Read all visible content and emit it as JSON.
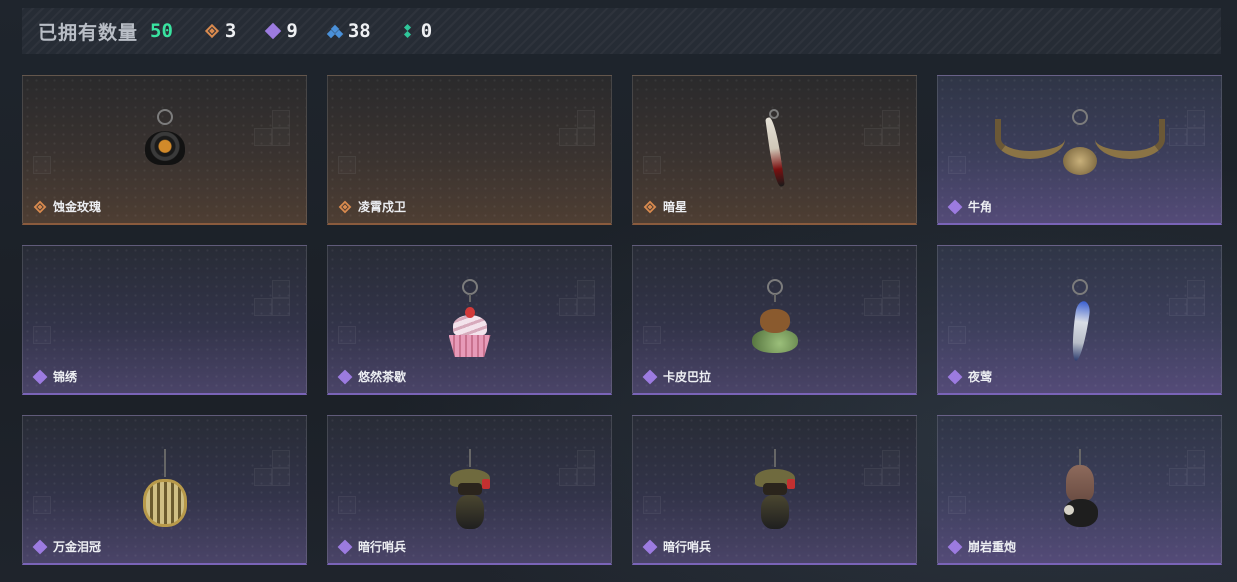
{
  "header": {
    "owned_label": "已拥有数量",
    "owned_count": "50",
    "stats": [
      {
        "icon": "orange-rarity-icon",
        "color": "#d98a4e",
        "value": "3"
      },
      {
        "icon": "purple-rarity-icon",
        "color": "#9c7be0",
        "value": "9"
      },
      {
        "icon": "blue-rarity-icon",
        "color": "#4a90d9",
        "value": "38"
      },
      {
        "icon": "green-rarity-icon",
        "color": "#2fc69a",
        "value": "0"
      }
    ]
  },
  "items": [
    {
      "name": "蚀金玫瑰",
      "rarity": "orange",
      "charm": "rose"
    },
    {
      "name": "凌霄戍卫",
      "rarity": "orange",
      "charm": "none"
    },
    {
      "name": "暗星",
      "rarity": "orange",
      "charm": "sword"
    },
    {
      "name": "牛角",
      "rarity": "purple",
      "charm": "horn"
    },
    {
      "name": "锦绣",
      "rarity": "purple",
      "charm": "none"
    },
    {
      "name": "悠然茶歇",
      "rarity": "purple",
      "charm": "cake"
    },
    {
      "name": "卡皮巴拉",
      "rarity": "purple",
      "charm": "capybara"
    },
    {
      "name": "夜莺",
      "rarity": "purple",
      "charm": "feather"
    },
    {
      "name": "万金泪冠",
      "rarity": "purple",
      "charm": "cage"
    },
    {
      "name": "暗行哨兵",
      "rarity": "purple",
      "charm": "soldier"
    },
    {
      "name": "暗行哨兵",
      "rarity": "purple",
      "charm": "soldier"
    },
    {
      "name": "崩岩重炮",
      "rarity": "purple",
      "charm": "rock"
    }
  ]
}
